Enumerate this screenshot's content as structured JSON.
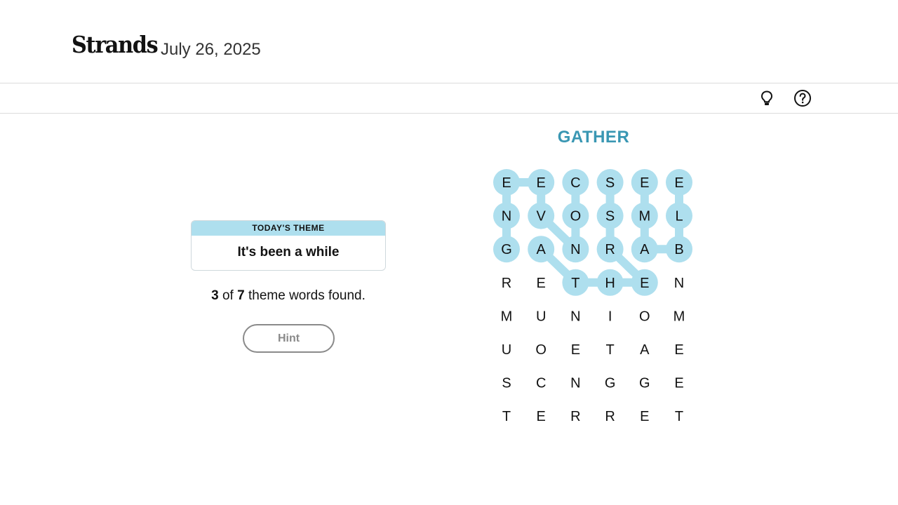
{
  "header": {
    "logo": "Strands",
    "date": "July 26, 2025"
  },
  "toolbar": {
    "icons": [
      "lightbulb-icon",
      "help-icon"
    ]
  },
  "theme": {
    "heading": "TODAY'S THEME",
    "text": "It's been a while"
  },
  "progress": {
    "found": "3",
    "of": "of",
    "total": "7",
    "suffix": "theme words found."
  },
  "hint": {
    "label": "Hint"
  },
  "current_word": "GATHER",
  "colors": {
    "highlight": "#aedfee",
    "current_word": "#3a97b3",
    "hint_disabled": "#8a8a8a"
  },
  "grid": {
    "rows": [
      [
        "E",
        "E",
        "C",
        "S",
        "E",
        "E"
      ],
      [
        "N",
        "V",
        "O",
        "S",
        "M",
        "L"
      ],
      [
        "G",
        "A",
        "N",
        "R",
        "A",
        "B"
      ],
      [
        "R",
        "E",
        "T",
        "H",
        "E",
        "N"
      ],
      [
        "M",
        "U",
        "N",
        "I",
        "O",
        "M"
      ],
      [
        "U",
        "O",
        "E",
        "T",
        "A",
        "E"
      ],
      [
        "S",
        "C",
        "N",
        "G",
        "G",
        "E"
      ],
      [
        "T",
        "E",
        "R",
        "R",
        "E",
        "T"
      ]
    ],
    "highlighted_paths": [
      [
        [
          2,
          0
        ],
        [
          1,
          0
        ],
        [
          0,
          0
        ],
        [
          0,
          1
        ],
        [
          1,
          1
        ],
        [
          2,
          2
        ],
        [
          1,
          2
        ],
        [
          0,
          2
        ]
      ],
      [
        [
          2,
          1
        ],
        [
          3,
          2
        ],
        [
          3,
          3
        ],
        [
          3,
          4
        ],
        [
          2,
          3
        ],
        [
          1,
          3
        ],
        [
          0,
          3
        ]
      ],
      [
        [
          0,
          4
        ],
        [
          1,
          4
        ],
        [
          2,
          4
        ],
        [
          2,
          5
        ],
        [
          1,
          5
        ],
        [
          0,
          5
        ]
      ]
    ]
  }
}
